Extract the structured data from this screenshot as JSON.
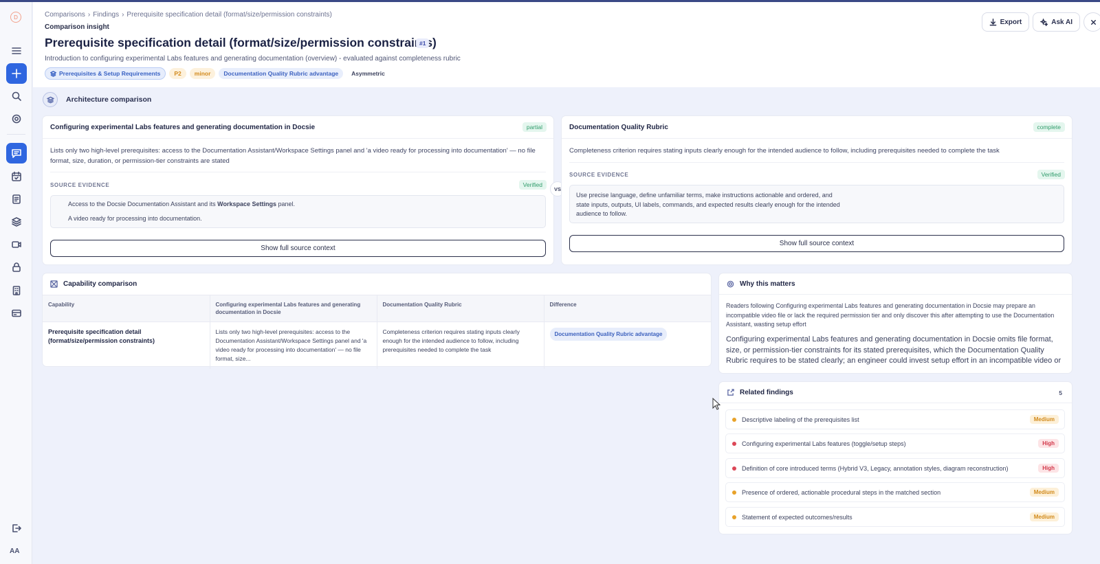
{
  "sidebar": {
    "items": [
      "logo-icon",
      "menu-icon",
      "plus-icon",
      "search-icon",
      "settings-icon",
      "chat-icon",
      "calendar-icon",
      "document-icon",
      "layers-icon",
      "video-icon",
      "lock-icon",
      "building-icon",
      "card-icon",
      "logout-icon"
    ],
    "font_size_label": "AA"
  },
  "header": {
    "breadcrumb": [
      "Comparisons",
      "›",
      "Findings",
      "›",
      "Prerequisite specification detail (format/size/permission constraints)"
    ],
    "kicker": "Comparison insight",
    "title": "Prerequisite specification detail (format/size/permission constraints)",
    "title_badge": "#1",
    "subtitle": "Introduction to configuring experimental Labs features and generating documentation (overview) - evaluated against completeness rubric",
    "tags": {
      "category": "Prerequisites & Setup Requirements",
      "priority": "P2",
      "severity": "minor",
      "advantage": "Documentation Quality Rubric advantage",
      "symmetry": "Asymmetric"
    },
    "export_label": "Export",
    "ask_ai_label": "Ask AI"
  },
  "architecture": {
    "title": "Architecture comparison",
    "vs_label": "VS",
    "left": {
      "title": "Configuring experimental Labs features and generating documentation in Docsie",
      "status": "partial",
      "summary": "Lists only two high-level prerequisites: access to the Documentation Assistant/Workspace Settings panel and 'a video ready for processing into documentation' — no file format, size, duration, or permission-tier constraints are stated",
      "evidence_label": "SOURCE EVIDENCE",
      "verified": "Verified",
      "evidence_line1_pre": "Access to the Docsie Documentation Assistant and its ",
      "evidence_line1_bold": "Workspace Settings",
      "evidence_line1_post": " panel.",
      "evidence_line2": "A video ready for processing into documentation.",
      "button": "Show full source context"
    },
    "right": {
      "title": "Documentation Quality Rubric",
      "status": "complete",
      "summary": "Completeness criterion requires stating inputs clearly enough for the intended audience to follow, including prerequisites needed to complete the task",
      "evidence_label": "SOURCE EVIDENCE",
      "verified": "Verified",
      "evidence_line1": "Use precise language, define unfamiliar terms, make instructions actionable and ordered, and",
      "evidence_line2": "state inputs, outputs, UI labels, commands, and expected results clearly enough for the intended",
      "evidence_line3": "audience to follow.",
      "button": "Show full source context"
    }
  },
  "capability": {
    "title": "Capability comparison",
    "columns": [
      "Capability",
      "Configuring experimental Labs features and generating documentation in Docsie",
      "Documentation Quality Rubric",
      "Difference"
    ],
    "row": {
      "capability": "Prerequisite specification detail (format/size/permission constraints)",
      "left": "Lists only two high-level prerequisites: access to the Documentation Assistant/Workspace Settings panel and 'a video ready for processing into documentation' — no file format, size...",
      "right": "Completeness criterion requires stating inputs clearly enough for the intended audience to follow, including prerequisites needed to complete the task",
      "difference": "Documentation Quality Rubric advantage"
    }
  },
  "why": {
    "title": "Why this matters",
    "text1": "Readers following Configuring experimental Labs features and generating documentation in Docsie may prepare an incompatible video file or lack the required permission tier and only discover this after attempting to use the Documentation Assistant, wasting setup effort",
    "text2": "Configuring experimental Labs features and generating documentation in Docsie omits file format, size, or permission-tier constraints for its stated prerequisites, which the Documentation Quality Rubric requires to be stated clearly; an engineer could invest setup effort in an incompatible video or"
  },
  "related": {
    "title": "Related findings",
    "count": "5",
    "items": [
      {
        "text": "Descriptive labeling of the prerequisites list",
        "severity": "Medium",
        "color": "#e8a22a"
      },
      {
        "text": "Configuring experimental Labs features (toggle/setup steps)",
        "severity": "High",
        "color": "#dc4757"
      },
      {
        "text": "Definition of core introduced terms (Hybrid V3, Legacy, annotation styles, diagram reconstruction)",
        "severity": "High",
        "color": "#dc4757"
      },
      {
        "text": "Presence of ordered, actionable procedural steps in the matched section",
        "severity": "Medium",
        "color": "#e8a22a"
      },
      {
        "text": "Statement of expected outcomes/results",
        "severity": "Medium",
        "color": "#e8a22a"
      }
    ]
  },
  "colors": {
    "accent": "#2f66e0",
    "partial_status": "#2f9b6a",
    "medium": "#d18a1c",
    "high": "#d2384a"
  }
}
